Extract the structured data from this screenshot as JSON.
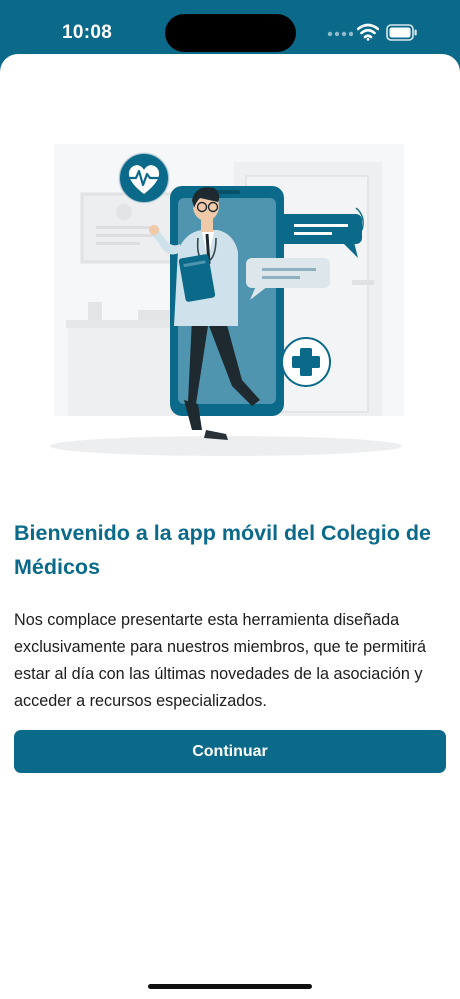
{
  "status_bar": {
    "time": "10:08",
    "icons": [
      "signal-icon",
      "wifi-icon",
      "battery-icon"
    ]
  },
  "illustration": {
    "subject": "doctor-stepping-out-of-phone-illustration",
    "icons": [
      "heart-pulse-icon",
      "chat-bubble-icon",
      "plus-cross-icon"
    ]
  },
  "welcome": {
    "title": "Bienvenido a la app móvil del Colegio de Médicos",
    "body": "Nos complace presentarte esta herramienta diseñada exclusivamente para nuestros miembros, que te permitirá estar al día con las últimas novedades de la asociación y acceder a recursos especializados."
  },
  "actions": {
    "continue_label": "Continuar"
  },
  "colors": {
    "brand": "#0b6a8a",
    "background": "#ffffff",
    "text": "#1c1c1e"
  }
}
